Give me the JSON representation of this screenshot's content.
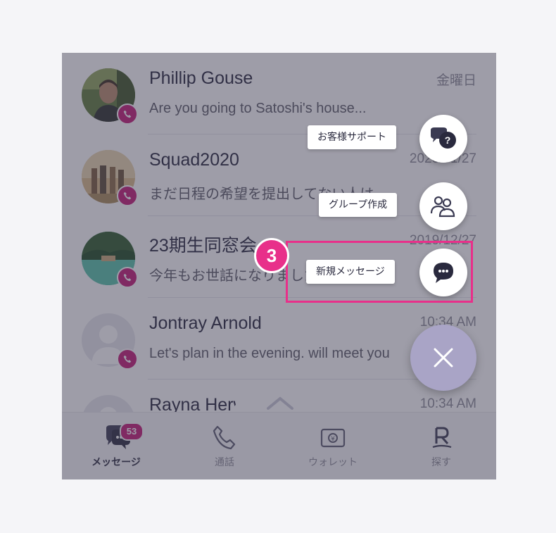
{
  "chats": [
    {
      "name": "Phillip Gouse",
      "message": "Are you going to Satoshi's house...",
      "time": "金曜日",
      "avatar": "photo-man"
    },
    {
      "name": "Squad2020",
      "message": "まだ日程の希望を提出してない人は、",
      "time": "2020/01/27",
      "avatar": "photo-group"
    },
    {
      "name": "23期生同窓会",
      "message": "今年もお世話になりました！来年も",
      "time": "2019/12/27",
      "avatar": "photo-lagoon"
    },
    {
      "name": "Jontray Arnold",
      "message": "Let's plan in the evening. will meet you",
      "time": "10:34 AM",
      "avatar": "default-user"
    },
    {
      "name": "Rayna Herwitz",
      "message": "",
      "time": "10:34 AM",
      "avatar": "default-user"
    }
  ],
  "fab_menu": [
    {
      "label": "お客様サポート",
      "icon": "support-chat-icon"
    },
    {
      "label": "グループ作成",
      "icon": "group-icon"
    },
    {
      "label": "新規メッセージ",
      "icon": "chat-bubble-icon"
    }
  ],
  "step_number": "3",
  "tabs": [
    {
      "label": "メッセージ",
      "icon": "messages-icon",
      "badge": "53",
      "active": true
    },
    {
      "label": "通話",
      "icon": "phone-icon"
    },
    {
      "label": "ウォレット",
      "icon": "wallet-icon"
    },
    {
      "label": "探す",
      "icon": "rakuten-r-icon"
    }
  ],
  "colors": {
    "brand": "#c21875",
    "highlight": "#e8308a",
    "fab": "#a9a4c6",
    "overlay": "rgba(62,60,82,0.5)"
  }
}
